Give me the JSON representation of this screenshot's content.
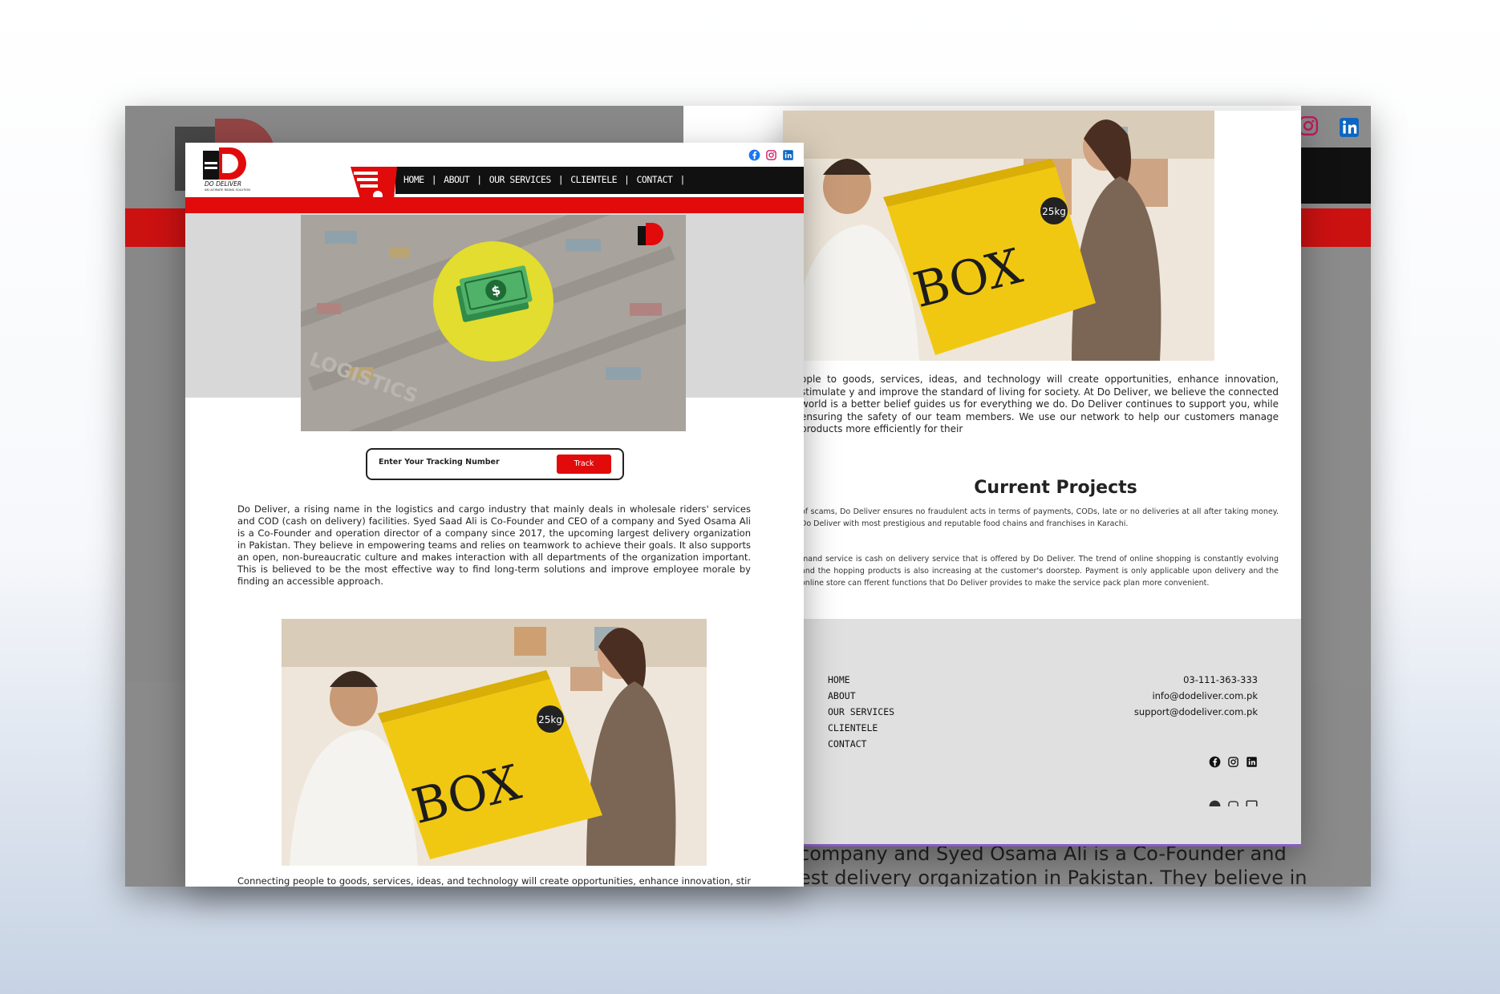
{
  "brand": {
    "name": "DO DELIVER",
    "tagline": "AN ULTIMATE RIDING SOLUTION",
    "colors": {
      "red": "#e10b0b",
      "black": "#111111",
      "footer_gray": "#e0e0e0"
    }
  },
  "nav": {
    "items": [
      "HOME",
      "ABOUT",
      "OUR SERVICES",
      "CLIENTELE",
      "CONTACT"
    ]
  },
  "social": {
    "icons": [
      "facebook-icon",
      "instagram-icon",
      "linkedin-icon"
    ]
  },
  "hero": {
    "watermark": "LOGISTICS",
    "icon": "dollar-bill-icon"
  },
  "tracking": {
    "placeholder": "Enter Your Tracking Number",
    "button": "Track"
  },
  "intro": {
    "text": "Do Deliver, a rising name in the logistics and cargo industry that mainly deals in wholesale riders' services and COD (cash on delivery) facilities. Syed Saad Ali is Co-Founder and CEO of a company and Syed Osama Ali is a Co-Founder and operation director of a company since 2017, the upcoming largest delivery organization in Pakistan. They believe in empowering teams and relies on teamwork to achieve their goals. It also supports an open, non-bureaucratic culture and makes interaction with all departments of the organization important. This is believed to be the most effective way to find long-term solutions and improve employee morale by finding an accessible approach."
  },
  "photo": {
    "box_label": "BOX",
    "weight_label": "25kg"
  },
  "connecting": {
    "front_line": "Connecting people to goods, services, ideas, and technology will create opportunities, enhance innovation, stimulate",
    "right_text": "ople to goods, services, ideas, and technology will create opportunities, enhance innovation, stimulate y and improve the standard of living for society. At Do Deliver, we believe the connected world is a better belief guides us for everything we do. Do Deliver continues to support you, while ensuring the safety of our team members. We use our network to help our customers manage products more efficiently for their"
  },
  "projects": {
    "title": "Current Projects",
    "p1": "of scams, Do Deliver ensures no fraudulent acts in terms of payments, CODs, late or no deliveries at all after taking money. Do Deliver with most prestigious and reputable food chains and franchises in Karachi.",
    "p2": "mand service is cash on delivery service that is offered by Do Deliver. The trend of online shopping is constantly evolving and the hopping products is also increasing at the customer's doorstep. Payment is only applicable upon delivery and the online store can fferent functions that Do Deliver provides to make the service pack plan more convenient."
  },
  "footer": {
    "nav": [
      "HOME",
      "ABOUT",
      "OUR SERVICES",
      "CLIENTELE",
      "CONTACT"
    ],
    "phone": "03-111-363-333",
    "email_info": "info@dodeliver.com.pk",
    "email_support": "support@dodeliver.com.pk"
  },
  "background": {
    "text_line1": "company and Syed Osama Ali is a Co-Founder and",
    "text_line2": "est delivery organization in Pakistan. They believe in"
  }
}
